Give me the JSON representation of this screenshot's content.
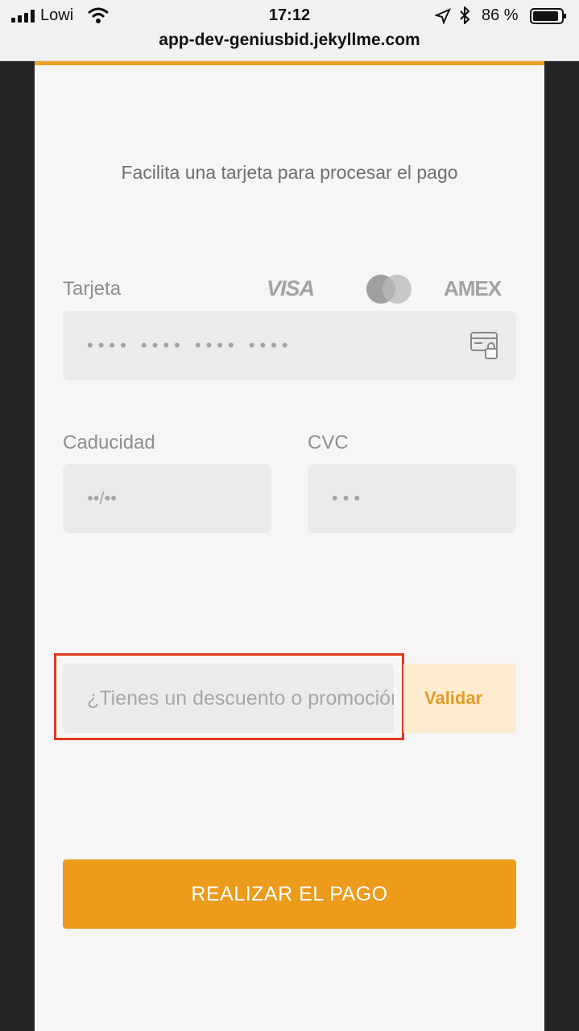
{
  "status_bar": {
    "carrier": "Lowi",
    "time": "17:12",
    "battery_percent": "86 %"
  },
  "browser": {
    "url": "app-dev-geniusbid.jekyllme.com"
  },
  "payment": {
    "intro": "Facilita una tarjeta para procesar el pago",
    "card_label": "Tarjeta",
    "brands": {
      "visa": "VISA",
      "amex": "AMEX"
    },
    "card_number_placeholder": "•••• •••• •••• ••••",
    "expiry_label": "Caducidad",
    "expiry_placeholder": "••/••",
    "cvc_label": "CVC",
    "cvc_placeholder": "•••",
    "promo_placeholder": "¿Tienes un descuento o promoción?",
    "validate_label": "Validar",
    "pay_button_label": "REALIZAR EL PAGO"
  },
  "colors": {
    "accent": "#ec9b1b",
    "validate_bg": "#fdecd0",
    "highlight_box": "#e03a1f"
  }
}
